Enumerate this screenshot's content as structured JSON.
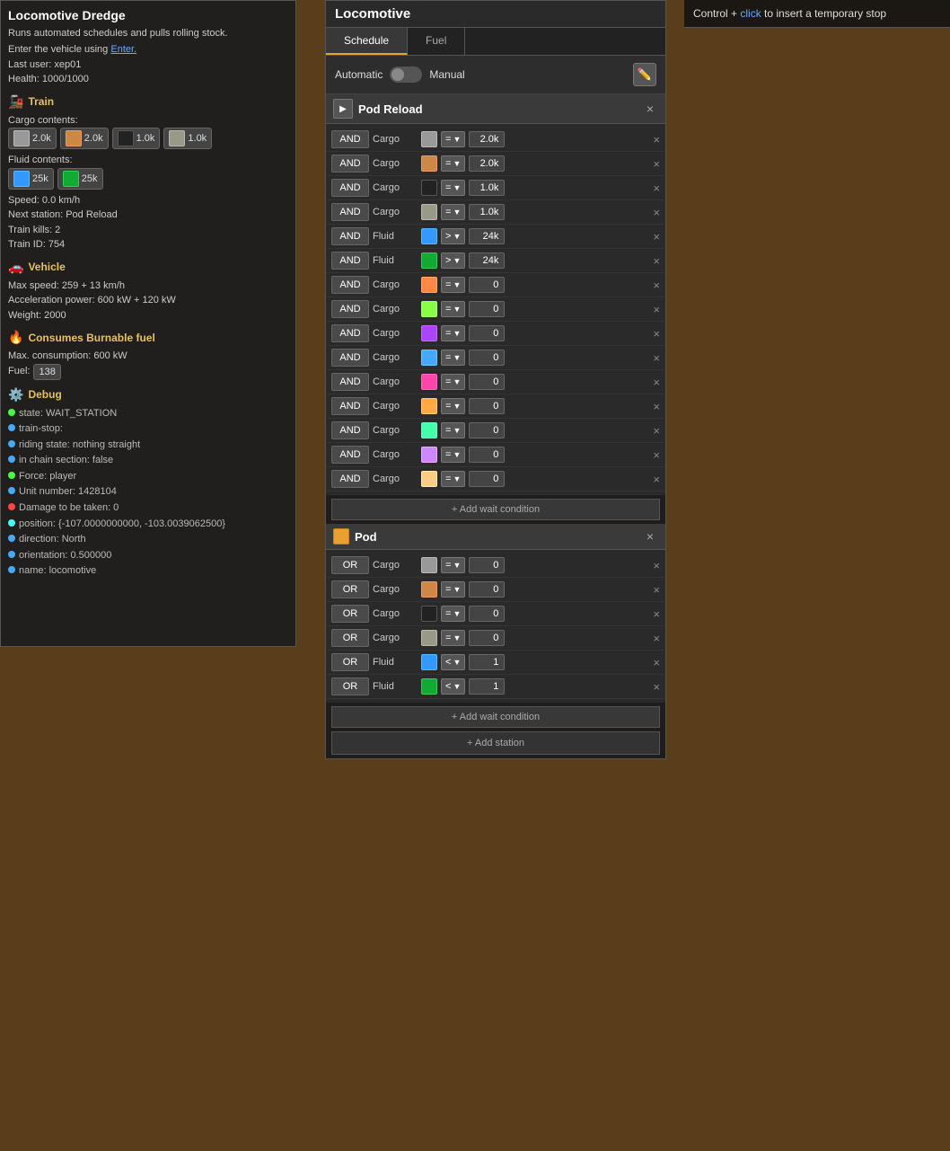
{
  "locomotive": {
    "title": "Locomotive Dredge",
    "desc": "Runs automated schedules and pulls rolling stock.",
    "enter_text": "Enter the vehicle using",
    "enter_link": "Enter.",
    "last_user": "Last user: xep01",
    "health": "Health: 1000/1000"
  },
  "train_section": {
    "header": "Train",
    "cargo_label": "Cargo contents:",
    "cargo_items": [
      {
        "value": "2.0k",
        "class": "icon-iron"
      },
      {
        "value": "2.0k",
        "class": "icon-copper"
      },
      {
        "value": "1.0k",
        "class": "icon-coal"
      },
      {
        "value": "1.0k",
        "class": "icon-stone"
      }
    ],
    "fluid_label": "Fluid contents:",
    "fluid_items": [
      {
        "value": "25k",
        "class": "icon-fluid1"
      },
      {
        "value": "25k",
        "class": "icon-fluid2"
      }
    ],
    "speed": "Speed: 0.0 km/h",
    "next_station": "Next station: Pod Reload",
    "train_kills": "Train kills: 2",
    "train_id": "Train ID: 754"
  },
  "vehicle_section": {
    "header": "Vehicle",
    "max_speed": "Max speed: 259 + 13  km/h",
    "accel": "Acceleration power: 600 kW + 120 kW",
    "weight": "Weight: 2000"
  },
  "fuel_section": {
    "header": "Consumes Burnable fuel",
    "max_consumption": "Max. consumption: 600 kW",
    "fuel_label": "Fuel:",
    "fuel_value": "138"
  },
  "debug_section": {
    "header": "Debug",
    "items": [
      {
        "color": "dot-green",
        "text": "state: WAIT_STATION"
      },
      {
        "color": "dot-blue",
        "text": "train-stop: <null>"
      },
      {
        "color": "dot-blue",
        "text": "riding state: nothing straight"
      },
      {
        "color": "dot-blue",
        "text": "in chain section: false"
      },
      {
        "color": "dot-green",
        "text": "Force: player"
      },
      {
        "color": "dot-blue",
        "text": "Unit number: 1428104"
      },
      {
        "color": "dot-red",
        "text": "Damage to be taken: 0"
      },
      {
        "color": "dot-cyan",
        "text": "position: {-107.0000000000, -103.0039062500}"
      },
      {
        "color": "dot-blue",
        "text": "direction: North"
      },
      {
        "color": "dot-blue",
        "text": "orientation: 0.500000"
      },
      {
        "color": "dot-blue",
        "text": "name: locomotive"
      }
    ]
  },
  "schedule_panel": {
    "title": "Locomotive",
    "tabs": [
      "Schedule",
      "Fuel"
    ],
    "active_tab": "Schedule",
    "auto_label": "Automatic",
    "manual_label": "Manual"
  },
  "station1": {
    "name": "Pod Reload",
    "icon": "play",
    "conditions": [
      {
        "connector": "AND",
        "type": "Cargo",
        "icon_class": "icon-iron",
        "op": "=",
        "value": "2.0k"
      },
      {
        "connector": "AND",
        "type": "Cargo",
        "icon_class": "icon-copper",
        "op": "=",
        "value": "2.0k"
      },
      {
        "connector": "AND",
        "type": "Cargo",
        "icon_class": "icon-coal",
        "op": "=",
        "value": "1.0k"
      },
      {
        "connector": "AND",
        "type": "Cargo",
        "icon_class": "icon-stone",
        "op": "=",
        "value": "1.0k"
      },
      {
        "connector": "AND",
        "type": "Fluid",
        "icon_class": "icon-fluid1",
        "op": ">",
        "value": "24k"
      },
      {
        "connector": "AND",
        "type": "Fluid",
        "icon_class": "icon-fluid2",
        "op": ">",
        "value": "24k"
      },
      {
        "connector": "AND",
        "type": "Cargo",
        "icon_class": "icon-item1",
        "op": "=",
        "value": "0"
      },
      {
        "connector": "AND",
        "type": "Cargo",
        "icon_class": "icon-item2",
        "op": "=",
        "value": "0"
      },
      {
        "connector": "AND",
        "type": "Cargo",
        "icon_class": "icon-item3",
        "op": "=",
        "value": "0"
      },
      {
        "connector": "AND",
        "type": "Cargo",
        "icon_class": "icon-item4",
        "op": "=",
        "value": "0"
      },
      {
        "connector": "AND",
        "type": "Cargo",
        "icon_class": "icon-item5",
        "op": "=",
        "value": "0"
      },
      {
        "connector": "AND",
        "type": "Cargo",
        "icon_class": "icon-item6",
        "op": "=",
        "value": "0"
      },
      {
        "connector": "AND",
        "type": "Cargo",
        "icon_class": "icon-item7",
        "op": "=",
        "value": "0"
      },
      {
        "connector": "AND",
        "type": "Cargo",
        "icon_class": "icon-item8",
        "op": "=",
        "value": "0"
      },
      {
        "connector": "AND",
        "type": "Cargo",
        "icon_class": "icon-item9",
        "op": "=",
        "value": "0"
      }
    ],
    "add_wait_label": "+ Add wait condition"
  },
  "station2": {
    "name": "Pod",
    "conditions": [
      {
        "connector": "OR",
        "type": "Cargo",
        "icon_class": "icon-iron",
        "op": "=",
        "value": "0"
      },
      {
        "connector": "OR",
        "type": "Cargo",
        "icon_class": "icon-copper",
        "op": "=",
        "value": "0"
      },
      {
        "connector": "OR",
        "type": "Cargo",
        "icon_class": "icon-coal",
        "op": "=",
        "value": "0"
      },
      {
        "connector": "OR",
        "type": "Cargo",
        "icon_class": "icon-stone",
        "op": "=",
        "value": "0"
      },
      {
        "connector": "OR",
        "type": "Fluid",
        "icon_class": "icon-fluid1",
        "op": "<",
        "value": "1"
      },
      {
        "connector": "OR",
        "type": "Fluid",
        "icon_class": "icon-fluid2",
        "op": "<",
        "value": "1"
      }
    ],
    "add_wait_label": "+ Add wait condition"
  },
  "add_station_label": "+ Add station",
  "top_bar": {
    "text": "Control + click to insert a temporary stop",
    "click_word": "click"
  }
}
